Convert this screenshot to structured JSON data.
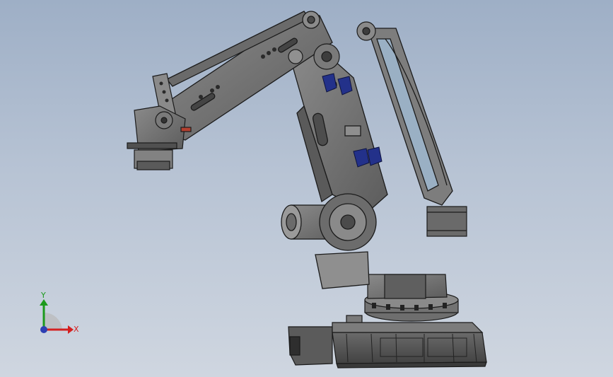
{
  "viewport": {
    "background_top": "#9eafc6",
    "background_bottom": "#cfd6e0",
    "model_color": "#6f6f6f",
    "edge_color": "#1b1b1b",
    "accent_blue": "#23318a"
  },
  "triad": {
    "x_label": "X",
    "y_label": "Y",
    "x_color": "#d42020",
    "y_color": "#1c9a1c",
    "z_color": "#2d3fb3"
  }
}
